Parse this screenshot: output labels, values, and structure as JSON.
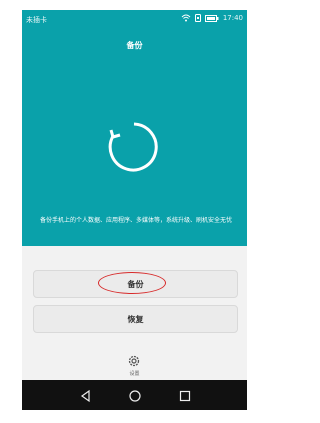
{
  "status_bar": {
    "carrier": "未插卡",
    "time": "17:40"
  },
  "page": {
    "title": "备份"
  },
  "description": "备份手机上的个人数据、应用程序、多媒体等，系统升级、刷机安全无忧",
  "buttons": {
    "backup": "备份",
    "restore": "恢复"
  },
  "settings": {
    "label": "设置"
  },
  "colors": {
    "hero": "#0aa1aa",
    "annotation": "#d72a2a"
  },
  "icons": {
    "sync": "sync-icon",
    "gear": "gear-icon",
    "nav": [
      "back-icon",
      "home-icon",
      "recent-apps-icon"
    ]
  }
}
